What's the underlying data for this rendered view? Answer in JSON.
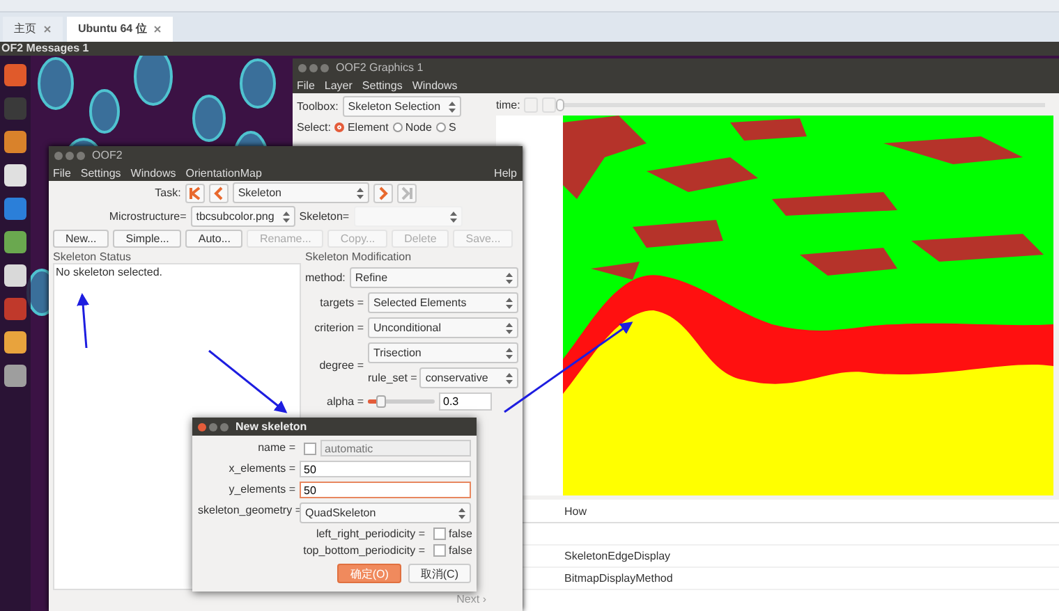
{
  "host_tabs": [
    {
      "label": "主页",
      "selected": false
    },
    {
      "label": "Ubuntu 64 位",
      "selected": true
    }
  ],
  "top_bar": {
    "title": "OF2 Messages 1"
  },
  "graphics_window": {
    "title": "OOF2 Graphics 1",
    "menu": [
      "File",
      "Layer",
      "Settings",
      "Windows"
    ],
    "toolbox": {
      "label": "Toolbox:",
      "value": "Skeleton Selection"
    },
    "time_label": "time:",
    "time_slider": {
      "level": 0
    },
    "select": {
      "label": "Select:",
      "options": [
        {
          "label": "Element",
          "selected": true
        },
        {
          "label": "Node",
          "selected": false
        },
        {
          "label": "S",
          "selected": false
        }
      ]
    },
    "layers": {
      "columns": [
        "How"
      ],
      "rows": [
        "",
        "SkeletonEdgeDisplay",
        "BitmapDisplayMethod"
      ]
    }
  },
  "main_window": {
    "title": "OOF2",
    "menu": [
      "File",
      "Settings",
      "Windows",
      "OrientationMap"
    ],
    "help": "Help",
    "task": {
      "label": "Task:",
      "value": "Skeleton"
    },
    "microstructure": {
      "label": "Microstructure=",
      "value": "tbcsubcolor.png"
    },
    "skeleton_label": "Skeleton=",
    "buttons": [
      {
        "label": "New...",
        "disabled": false
      },
      {
        "label": "Simple...",
        "disabled": false
      },
      {
        "label": "Auto...",
        "disabled": false
      },
      {
        "label": "Rename...",
        "disabled": true
      },
      {
        "label": "Copy...",
        "disabled": true
      },
      {
        "label": "Delete",
        "disabled": true
      },
      {
        "label": "Save...",
        "disabled": true
      }
    ],
    "status": {
      "title": "Skeleton Status",
      "text": "No skeleton selected."
    },
    "modification": {
      "title": "Skeleton Modification",
      "method": {
        "label": "method:",
        "value": "Refine"
      },
      "params": [
        {
          "label": "targets =",
          "value": "Selected Elements"
        },
        {
          "label": "criterion =",
          "value": "Unconditional"
        }
      ],
      "degree": {
        "label": "degree =",
        "value": "Trisection",
        "rule_label": "rule_set =",
        "rule_value": "conservative"
      },
      "alpha": {
        "label": "alpha =",
        "level": 0.2,
        "value": "0.3"
      }
    },
    "next": "Next ›"
  },
  "dialog": {
    "title": "New skeleton",
    "fields": [
      {
        "kind": "check",
        "label": "name =",
        "placeholder": "automatic",
        "checked": false
      },
      {
        "kind": "input",
        "label": "x_elements =",
        "value": "50",
        "focused": false
      },
      {
        "kind": "input",
        "label": "y_elements =",
        "value": "50",
        "focused": true
      }
    ],
    "geometry": {
      "label": "skeleton_geometry =",
      "value": "QuadSkeleton",
      "options": [
        {
          "label": "left_right_periodicity =",
          "checked": false,
          "text": "false"
        },
        {
          "label": "top_bottom_periodicity =",
          "checked": false,
          "text": "false"
        }
      ]
    },
    "buttons": [
      {
        "label": "确定(O)",
        "primary": true
      },
      {
        "label": "取消(C)",
        "primary": false
      }
    ]
  }
}
